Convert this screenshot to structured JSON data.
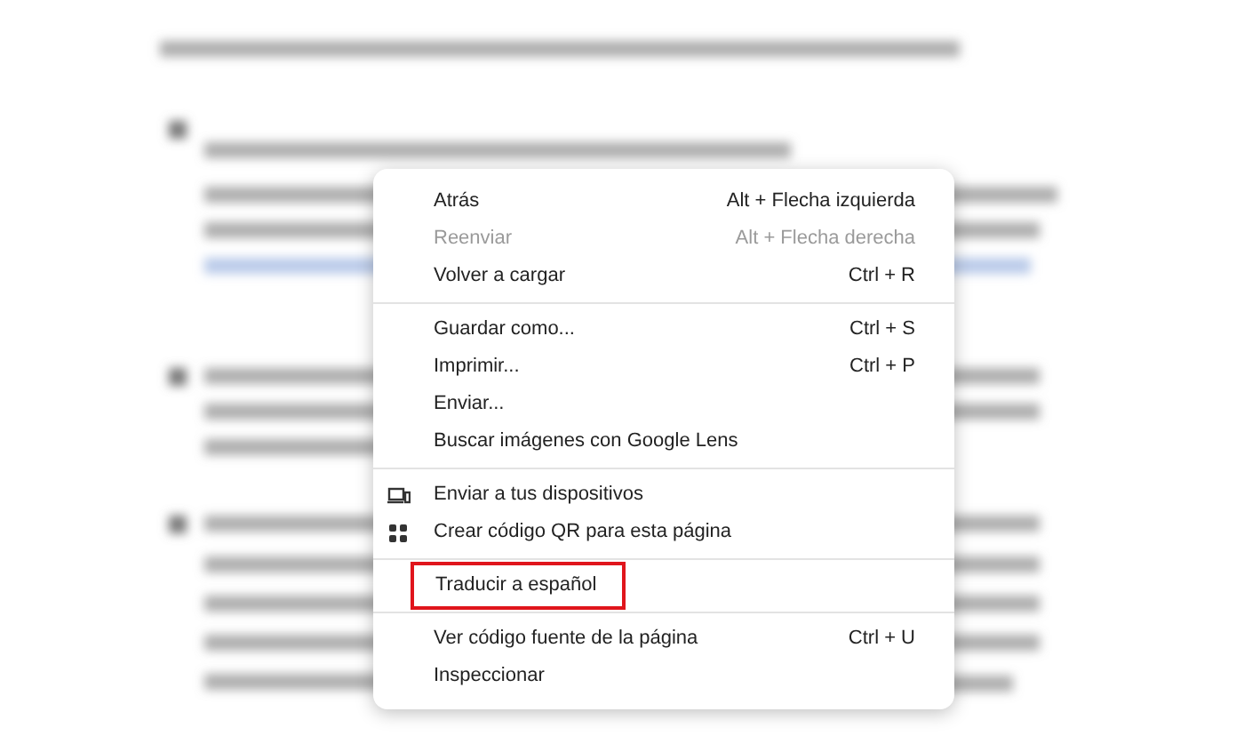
{
  "context_menu": {
    "groups": [
      {
        "items": [
          {
            "label": "Atrás",
            "shortcut": "Alt + Flecha izquierda",
            "disabled": false
          },
          {
            "label": "Reenviar",
            "shortcut": "Alt + Flecha derecha",
            "disabled": true
          },
          {
            "label": "Volver a cargar",
            "shortcut": "Ctrl + R",
            "disabled": false
          }
        ]
      },
      {
        "items": [
          {
            "label": "Guardar como...",
            "shortcut": "Ctrl + S",
            "disabled": false
          },
          {
            "label": "Imprimir...",
            "shortcut": "Ctrl + P",
            "disabled": false
          },
          {
            "label": "Enviar...",
            "disabled": false
          },
          {
            "label": "Buscar imágenes con Google Lens",
            "disabled": false
          }
        ]
      },
      {
        "items": [
          {
            "label": "Enviar a tus dispositivos",
            "kind": "devices",
            "disabled": false
          },
          {
            "label": "Crear código QR para esta página",
            "kind": "qr",
            "disabled": false
          }
        ]
      },
      {
        "items": [
          {
            "label": "Traducir a español",
            "disabled": false,
            "highlighted": true
          }
        ]
      },
      {
        "items": [
          {
            "label": "Ver código fuente de la página",
            "shortcut": "Ctrl + U",
            "disabled": false
          },
          {
            "label": "Inspeccionar",
            "disabled": false
          }
        ]
      }
    ]
  }
}
